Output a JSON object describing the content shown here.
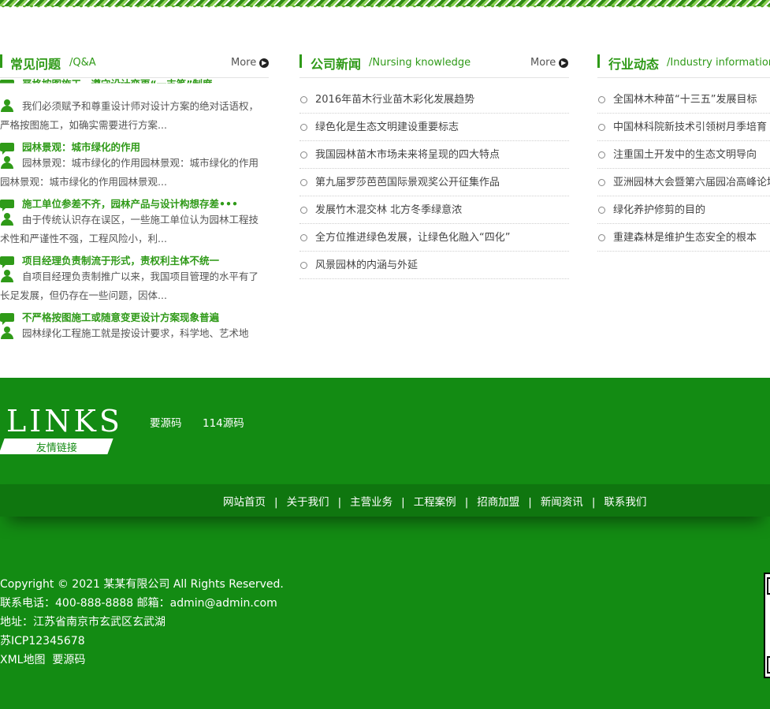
{
  "faq": {
    "title": "常见问题",
    "subtitle": "/Q&A",
    "more": "More",
    "cut_q": "严格按图施工，遵守设计变更“一支笔”制度",
    "items": [
      {
        "a": "我们必须赋予和尊重设计师对设计方案的绝对话语权，严格按图施工，如确实需要进行方案..."
      },
      {
        "q": "园林景观：城市绿化的作用",
        "a": "园林景观：城市绿化的作用园林景观：城市绿化的作用园林景观：城市绿化的作用园林景观..."
      },
      {
        "q": "施工单位参差不齐，园林产品与设计构想存差•••",
        "a": "由于传统认识存在误区，一些施工单位认为园林工程技术性和严谨性不强，工程风险小，利..."
      },
      {
        "q": "项目经理负责制流于形式，责权利主体不统一",
        "a": "自项目经理负责制推广以来，我国项目管理的水平有了长足发展，但仍存在一些问题，因体..."
      },
      {
        "q": "不严格按图施工或随意变更设计方案现象普遍",
        "a": "园林绿化工程施工就是按设计要求，科学地、艺术地"
      }
    ]
  },
  "news": {
    "title": "公司新闻",
    "subtitle": "/Nursing knowledge",
    "more": "More",
    "items": [
      "2016年苗木行业苗木彩化发展趋势",
      "绿色化是生态文明建设重要标志",
      "我国园林苗木市场未来将呈现的四大特点",
      "第九届罗莎芭芭国际景观奖公开征集作品",
      "发展竹木混交林 北方冬季绿意浓",
      "全方位推进绿色发展，让绿色化融入“四化”",
      "风景园林的内涵与外延"
    ]
  },
  "industry": {
    "title": "行业动态",
    "subtitle": "/Industry information",
    "items": [
      "全国林木种苗“十三五”发展目标",
      "中国林科院新技术引领树月季培育",
      "注重国土开发中的生态文明导向",
      "亚洲园林大会暨第六届园冶高峰论坛",
      "绿化养护修剪的目的",
      "重建森林是维护生态安全的根本"
    ]
  },
  "links": {
    "logo": "LINKS",
    "tag": "友情链接",
    "items": [
      "要源码",
      "114源码"
    ]
  },
  "nav": {
    "separator": "|",
    "items": [
      "网站首页",
      "关于我们",
      "主营业务",
      "工程案例",
      "招商加盟",
      "新闻资讯",
      "联系我们"
    ]
  },
  "footer": {
    "copyright": "Copyright © 2021 某某有限公司 All Rights Reserved.",
    "contact": "联系电话：400-888-8888  邮箱：admin@admin.com",
    "address": "地址：江苏省南京市玄武区玄武湖",
    "icp": "苏ICP12345678",
    "xml": "XML地图",
    "xml_link2": "要源码"
  },
  "colors": {
    "brand_green": "#2f9a18",
    "footer_green": "#138b13",
    "nav_dark_green": "#0f760f"
  }
}
